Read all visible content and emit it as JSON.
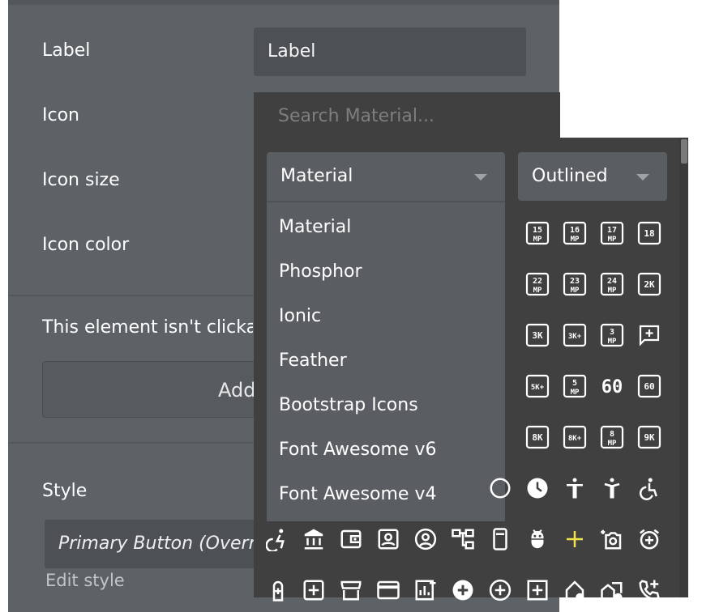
{
  "properties": {
    "label_row": {
      "label": "Label",
      "value": "Label"
    },
    "icon_label": "Icon",
    "icon_size_label": "Icon size",
    "icon_color_label": "Icon color",
    "not_clickable_text": "This element isn't clickable",
    "add_button_label": "Add workflow",
    "style_label": "Style",
    "style_value": "Primary Button (Overridden)",
    "edit_style_link": "Edit style"
  },
  "picker": {
    "search_placeholder": "Search Material...",
    "library_select": "Material",
    "variant_select": "Outlined",
    "library_options": [
      "Material",
      "Phosphor",
      "Ionic",
      "Feather",
      "Bootstrap Icons",
      "Font Awesome v6",
      "Font Awesome v4"
    ],
    "icons": [
      {
        "name": "15mp-icon",
        "a": "15",
        "b": "MP"
      },
      {
        "name": "16mp-icon",
        "a": "16",
        "b": "MP"
      },
      {
        "name": "17mp-icon",
        "a": "17",
        "b": "MP"
      },
      {
        "name": "18-icon",
        "a": "18",
        "b": ""
      },
      {
        "name": "22mp-icon",
        "a": "22",
        "b": "MP"
      },
      {
        "name": "23mp-icon",
        "a": "23",
        "b": "MP"
      },
      {
        "name": "24mp-icon",
        "a": "24",
        "b": "MP"
      },
      {
        "name": "2k-icon",
        "a": "2K",
        "b": ""
      },
      {
        "name": "3k-icon",
        "a": "3K",
        "b": ""
      },
      {
        "name": "3k-plus-icon",
        "a": "3K+",
        "b": ""
      },
      {
        "name": "3mp-icon",
        "a": "3",
        "b": "MP"
      },
      {
        "name": "5k-plus-icon",
        "a": "5K+",
        "b": ""
      },
      {
        "name": "5mp-icon",
        "a": "5",
        "b": "MP"
      },
      {
        "name": "60fps-icon",
        "a": "60",
        "b": ""
      },
      {
        "name": "60fps-select-icon",
        "a": "60",
        "b": ""
      },
      {
        "name": "8k-icon",
        "a": "8K",
        "b": ""
      },
      {
        "name": "8k-plus-icon",
        "a": "8K+",
        "b": ""
      },
      {
        "name": "8mp-icon",
        "a": "8",
        "b": "MP"
      },
      {
        "name": "9k-icon",
        "a": "9K",
        "b": ""
      }
    ],
    "accent_color": "#f3e34a"
  }
}
